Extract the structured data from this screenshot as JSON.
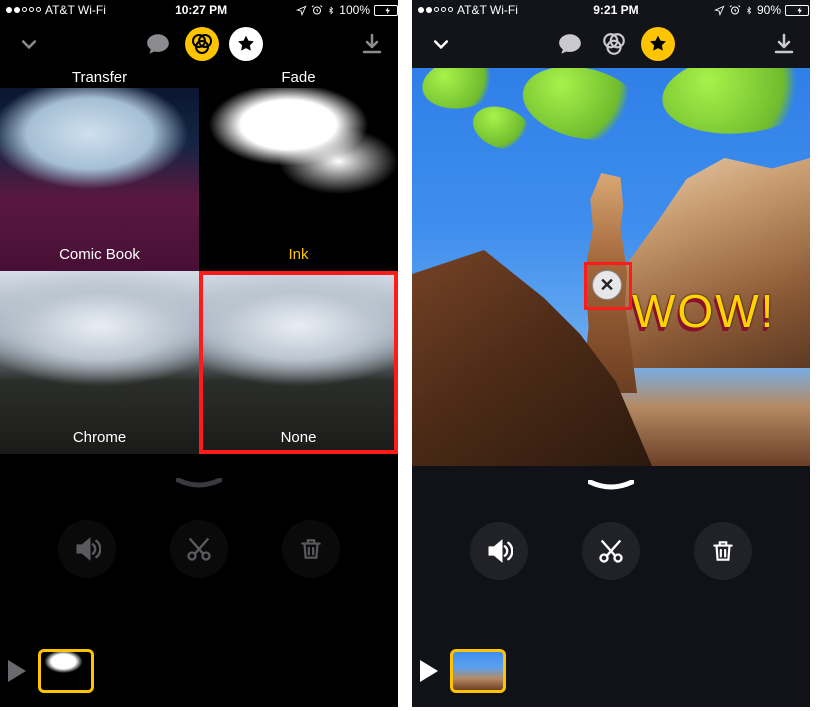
{
  "left": {
    "status": {
      "carrier": "AT&T Wi-Fi",
      "time": "10:27 PM",
      "battery_pct": "100%",
      "battery_fill": 100
    },
    "toolbar": {
      "collapse_icon": "chevron-down",
      "speech_icon": "speech-bubble",
      "filters_icon": "filters-venn",
      "filters_active": true,
      "star_icon": "star",
      "star_active": false,
      "download_icon": "download"
    },
    "filters_header": {
      "left": "Transfer",
      "right": "Fade"
    },
    "filters": [
      {
        "name": "Comic Book",
        "style": "bg-comic",
        "selected": false
      },
      {
        "name": "Ink",
        "style": "bg-ink",
        "selected": "gold"
      },
      {
        "name": "Chrome",
        "style": "bg-mountain",
        "selected": false
      },
      {
        "name": "None",
        "style": "bg-mountain",
        "selected": true
      }
    ],
    "actions": {
      "sound": "sound-icon",
      "cut": "scissors-icon",
      "delete": "trash-icon"
    }
  },
  "right": {
    "status": {
      "carrier": "AT&T Wi-Fi",
      "time": "9:21 PM",
      "battery_pct": "90%",
      "battery_fill": 90
    },
    "toolbar": {
      "collapse_icon": "chevron-down",
      "speech_icon": "speech-bubble",
      "filters_icon": "filters-venn",
      "filters_active": false,
      "star_icon": "star",
      "star_active": true,
      "download_icon": "download"
    },
    "overlay": {
      "text": "WOW!",
      "close_icon": "close"
    },
    "actions": {
      "sound": "sound-icon",
      "cut": "scissors-icon",
      "delete": "trash-icon"
    }
  },
  "colors": {
    "accent": "#ffc400",
    "select": "#ff1b1b",
    "battery": "#4cd964"
  }
}
